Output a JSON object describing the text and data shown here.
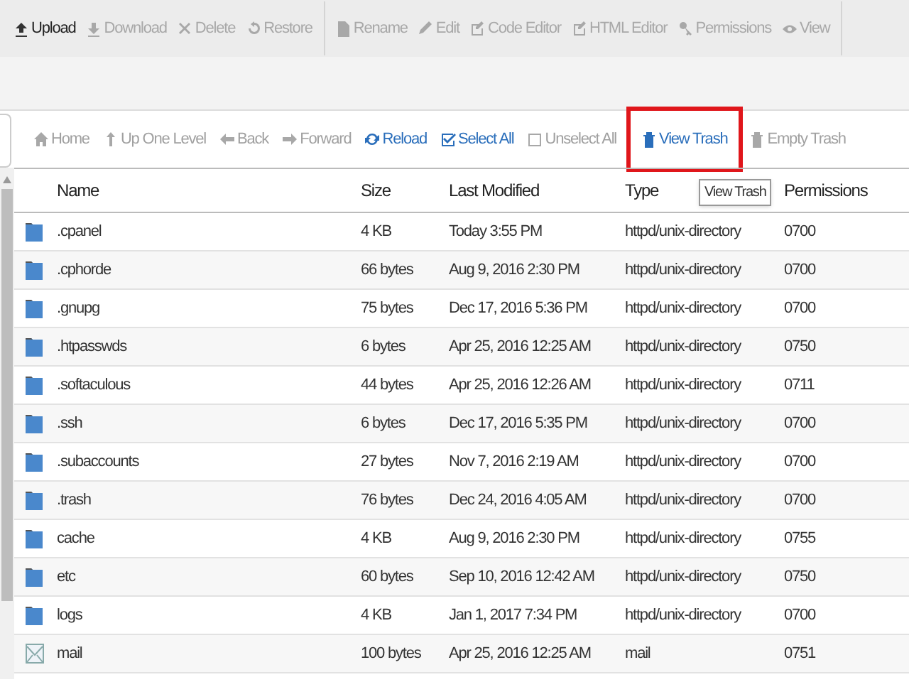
{
  "toolbar": [
    {
      "label": "Upload",
      "disabled": false
    },
    {
      "label": "Download",
      "disabled": true
    },
    {
      "label": "Delete",
      "disabled": true
    },
    {
      "label": "Restore",
      "disabled": true
    },
    {
      "label": "Rename",
      "disabled": true
    },
    {
      "label": "Edit",
      "disabled": true
    },
    {
      "label": "Code Editor",
      "disabled": true
    },
    {
      "label": "HTML Editor",
      "disabled": true
    },
    {
      "label": "Permissions",
      "disabled": true
    },
    {
      "label": "View",
      "disabled": true
    }
  ],
  "navbar": [
    {
      "label": "Home",
      "disabled": true,
      "highlighted": false
    },
    {
      "label": "Up One Level",
      "disabled": true,
      "highlighted": false
    },
    {
      "label": "Back",
      "disabled": true,
      "highlighted": false
    },
    {
      "label": "Forward",
      "disabled": true,
      "highlighted": false
    },
    {
      "label": "Reload",
      "disabled": false,
      "highlighted": false
    },
    {
      "label": "Select All",
      "disabled": false,
      "highlighted": false
    },
    {
      "label": "Unselect All",
      "disabled": true,
      "highlighted": false
    },
    {
      "label": "View Trash",
      "disabled": false,
      "highlighted": true
    },
    {
      "label": "Empty Trash",
      "disabled": true,
      "highlighted": false
    }
  ],
  "tooltip": "View Trash",
  "table": {
    "columns": [
      "Name",
      "Size",
      "Last Modified",
      "Type",
      "Permissions"
    ],
    "rows": [
      {
        "kind": "folder",
        "cells": [
          ".cpanel",
          "4 KB",
          "Today 3:55 PM",
          "httpd/unix-directory",
          "0700"
        ]
      },
      {
        "kind": "folder",
        "cells": [
          ".cphorde",
          "66 bytes",
          "Aug 9, 2016 2:30 PM",
          "httpd/unix-directory",
          "0700"
        ]
      },
      {
        "kind": "folder",
        "cells": [
          ".gnupg",
          "75 bytes",
          "Dec 17, 2016 5:36 PM",
          "httpd/unix-directory",
          "0700"
        ]
      },
      {
        "kind": "folder",
        "cells": [
          ".htpasswds",
          "6 bytes",
          "Apr 25, 2016 12:25 AM",
          "httpd/unix-directory",
          "0750"
        ]
      },
      {
        "kind": "folder",
        "cells": [
          ".softaculous",
          "44 bytes",
          "Apr 25, 2016 12:26 AM",
          "httpd/unix-directory",
          "0711"
        ]
      },
      {
        "kind": "folder",
        "cells": [
          ".ssh",
          "6 bytes",
          "Dec 17, 2016 5:35 PM",
          "httpd/unix-directory",
          "0700"
        ]
      },
      {
        "kind": "folder",
        "cells": [
          ".subaccounts",
          "27 bytes",
          "Nov 7, 2016 2:19 AM",
          "httpd/unix-directory",
          "0700"
        ]
      },
      {
        "kind": "folder",
        "cells": [
          ".trash",
          "76 bytes",
          "Dec 24, 2016 4:05 AM",
          "httpd/unix-directory",
          "0700"
        ]
      },
      {
        "kind": "folder",
        "cells": [
          "cache",
          "4 KB",
          "Aug 9, 2016 2:30 PM",
          "httpd/unix-directory",
          "0755"
        ]
      },
      {
        "kind": "folder",
        "cells": [
          "etc",
          "60 bytes",
          "Sep 10, 2016 12:42 AM",
          "httpd/unix-directory",
          "0750"
        ]
      },
      {
        "kind": "folder",
        "cells": [
          "logs",
          "4 KB",
          "Jan 1, 2017 7:34 PM",
          "httpd/unix-directory",
          "0700"
        ]
      },
      {
        "kind": "mail",
        "cells": [
          "mail",
          "100 bytes",
          "Apr 25, 2016 12:25 AM",
          "mail",
          "0751"
        ]
      }
    ]
  }
}
